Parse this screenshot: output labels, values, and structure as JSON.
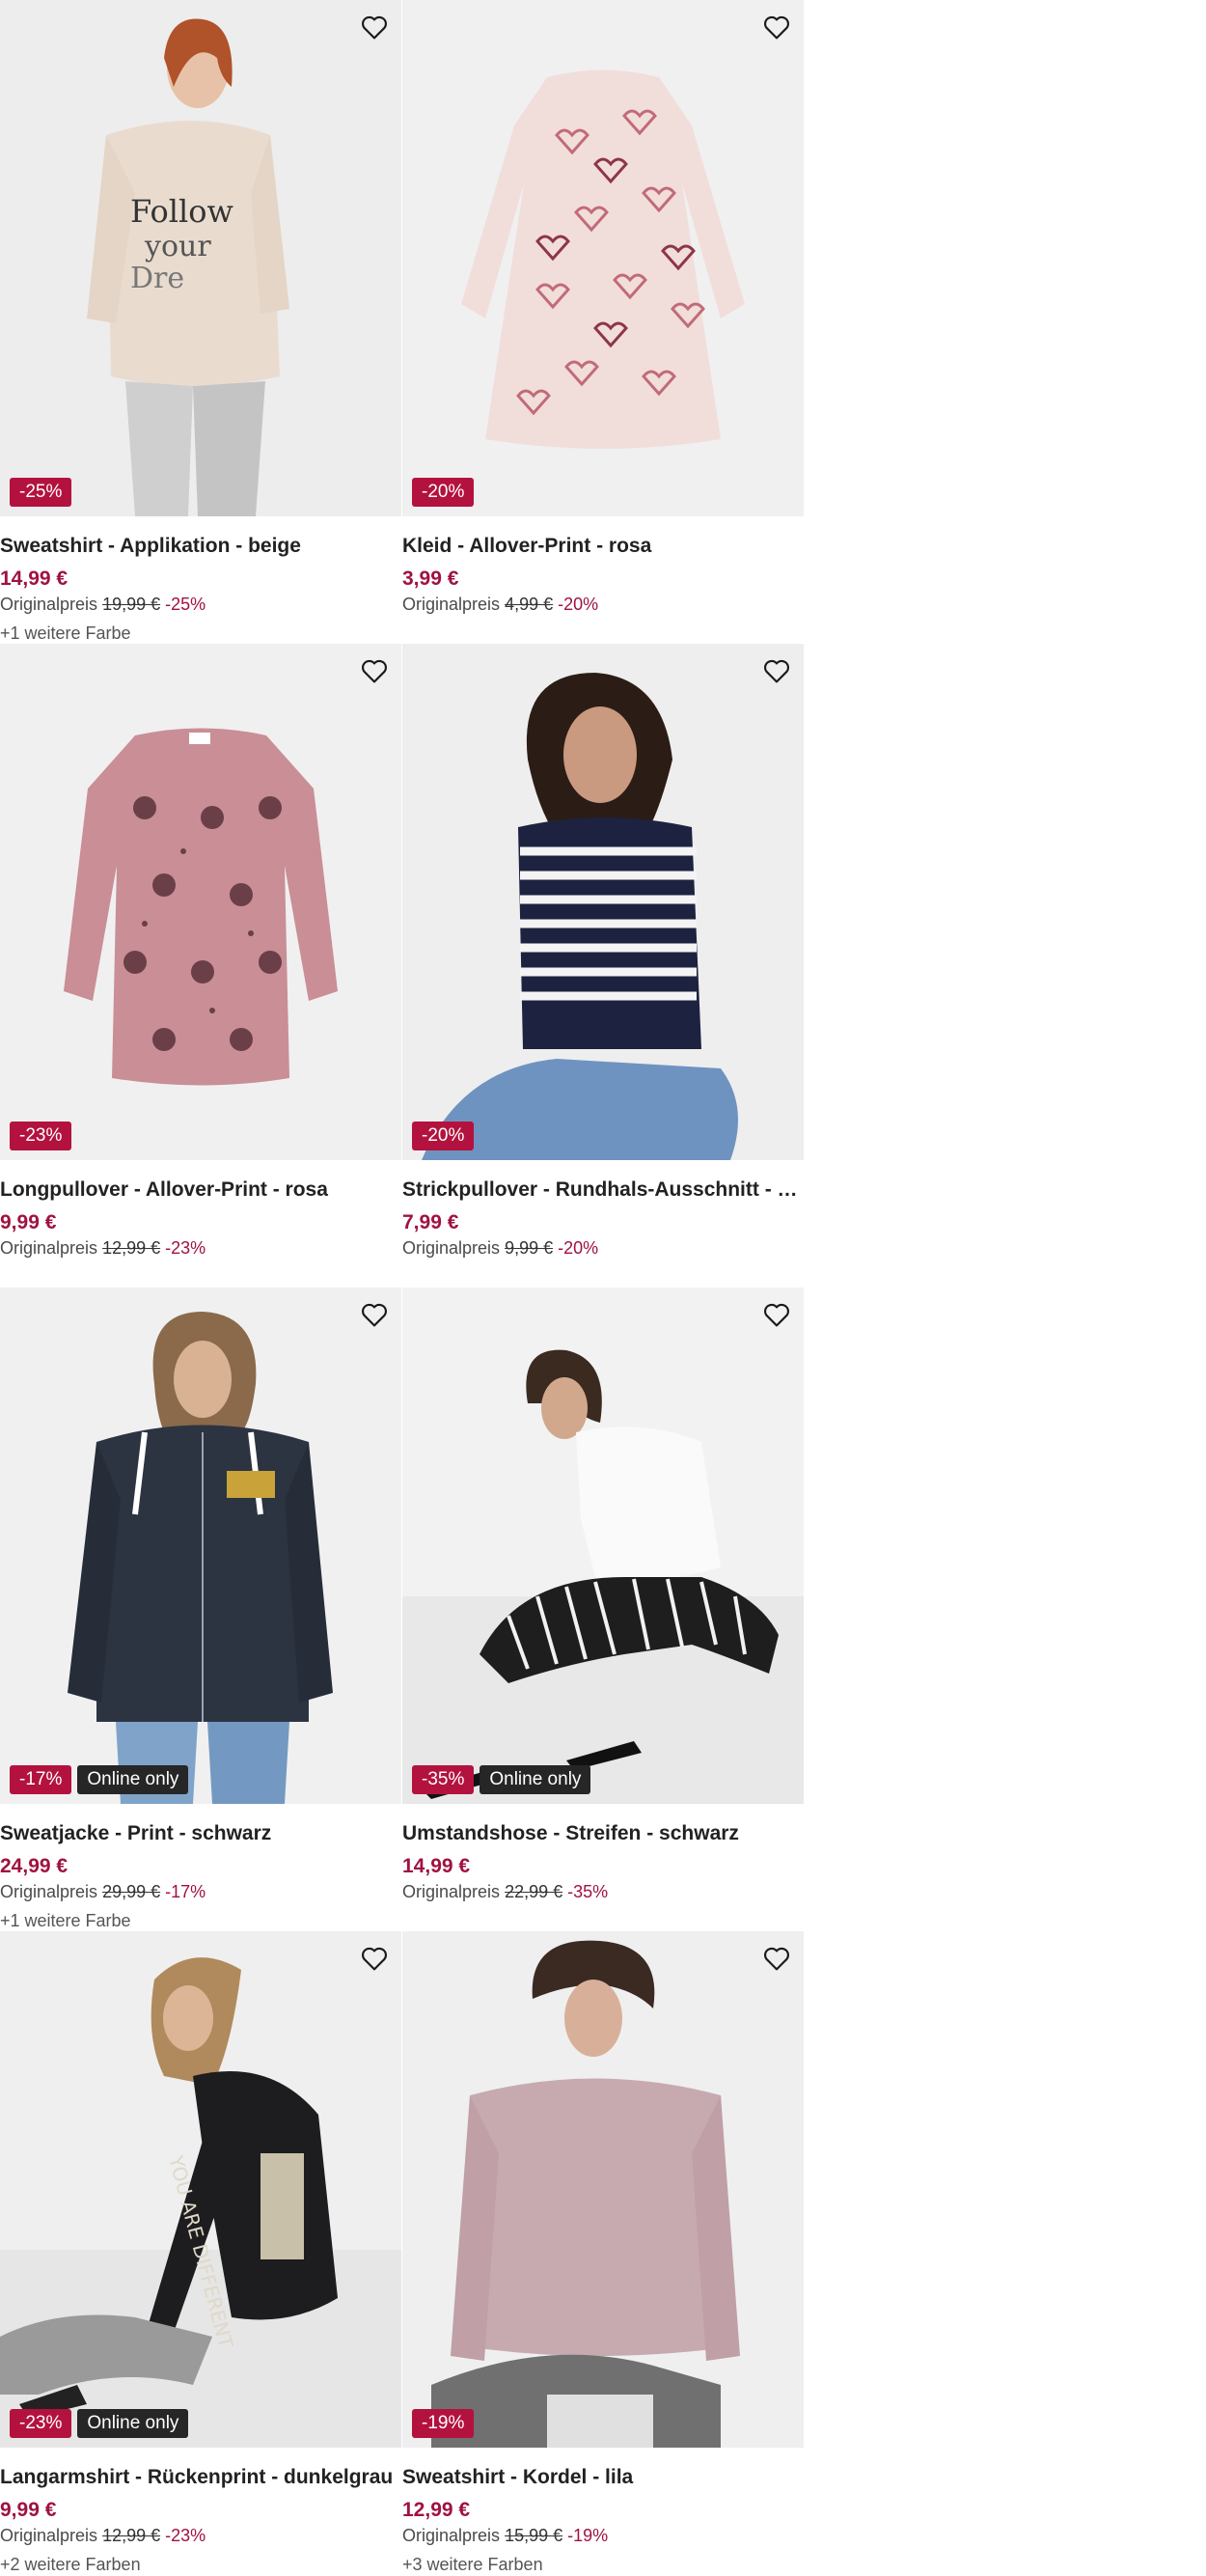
{
  "labels": {
    "original_price": "Originalpreis"
  },
  "colors": {
    "accent": "#a0123f",
    "badge_red": "#b3123f",
    "badge_dark": "#262626",
    "image_bg": "#f2f2f2"
  },
  "products": [
    {
      "name": "Sweatshirt - Applikation - beige",
      "price": "14,99 €",
      "original": "19,99 €",
      "discount": "-25%",
      "badge": "-25%",
      "online_only": "",
      "more_colors": "+1 weitere Farbe",
      "icon": "heart-outline-icon"
    },
    {
      "name": "Kleid - Allover-Print - rosa",
      "price": "3,99 €",
      "original": "4,99 €",
      "discount": "-20%",
      "badge": "-20%",
      "online_only": "",
      "more_colors": "",
      "icon": "heart-outline-icon"
    },
    {
      "name": "Longpullover - Allover-Print - rosa",
      "price": "9,99 €",
      "original": "12,99 €",
      "discount": "-23%",
      "badge": "-23%",
      "online_only": "",
      "more_colors": "",
      "icon": "heart-outline-icon"
    },
    {
      "name": "Strickpullover - Rundhals-Ausschnitt - dunk...",
      "price": "7,99 €",
      "original": "9,99 €",
      "discount": "-20%",
      "badge": "-20%",
      "online_only": "",
      "more_colors": "",
      "icon": "heart-outline-icon"
    },
    {
      "name": "Sweatjacke - Print - schwarz",
      "price": "24,99 €",
      "original": "29,99 €",
      "discount": "-17%",
      "badge": "-17%",
      "online_only": "Online only",
      "more_colors": "+1 weitere Farbe",
      "icon": "heart-outline-icon"
    },
    {
      "name": "Umstandshose - Streifen - schwarz",
      "price": "14,99 €",
      "original": "22,99 €",
      "discount": "-35%",
      "badge": "-35%",
      "online_only": "Online only",
      "more_colors": "",
      "icon": "heart-outline-icon"
    },
    {
      "name": "Langarmshirt - Rückenprint - dunkelgrau",
      "price": "9,99 €",
      "original": "12,99 €",
      "discount": "-23%",
      "badge": "-23%",
      "online_only": "Online only",
      "more_colors": "+2 weitere Farben",
      "icon": "heart-outline-icon"
    },
    {
      "name": "Sweatshirt - Kordel - lila",
      "price": "12,99 €",
      "original": "15,99 €",
      "discount": "-19%",
      "badge": "-19%",
      "online_only": "",
      "more_colors": "+3 weitere Farben",
      "icon": "heart-outline-icon"
    }
  ]
}
